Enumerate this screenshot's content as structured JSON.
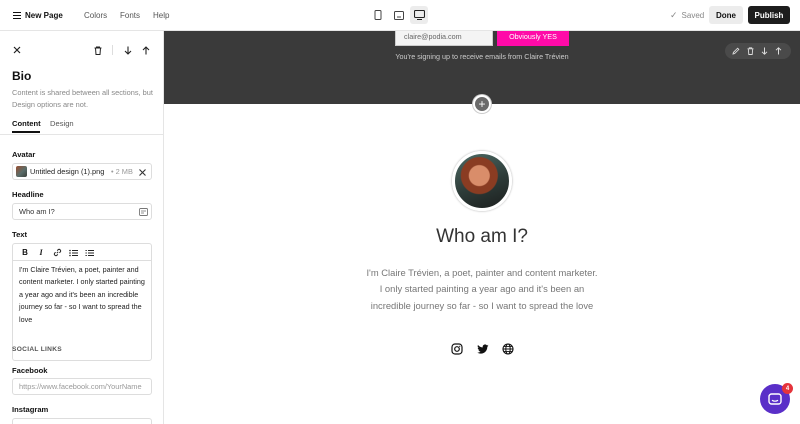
{
  "topbar": {
    "new_page": "New Page",
    "nav": {
      "colors": "Colors",
      "fonts": "Fonts",
      "help": "Help"
    },
    "saved": "Saved",
    "done": "Done",
    "publish": "Publish",
    "active_device": "desktop"
  },
  "sidebar": {
    "title": "Bio",
    "description": "Content is shared between all sections, but Design options are not.",
    "tabs": {
      "content": "Content",
      "design": "Design",
      "active": "Content"
    },
    "avatar": {
      "label": "Avatar",
      "file_name": "Untitled design (1).png",
      "file_size": "• 2 MB"
    },
    "headline": {
      "label": "Headline",
      "value": "Who am I?"
    },
    "text": {
      "label": "Text",
      "value": "I'm Claire Trévien, a poet, painter and content marketer. I only started painting a year ago and it's been an incredible journey so far - so I want to spread the love"
    },
    "social_links": {
      "heading": "SOCIAL LINKS",
      "facebook": {
        "label": "Facebook",
        "placeholder": "https://www.facebook.com/YourName"
      },
      "instagram": {
        "label": "Instagram"
      }
    }
  },
  "canvas": {
    "email_section": {
      "email_value": "claire@podia.com",
      "button_label": "Obviously YES",
      "note": "You're signing up to receive emails from Claire Trévien"
    },
    "bio": {
      "heading": "Who am I?",
      "text": "I'm Claire Trévien, a poet, painter and content marketer. I only started painting a year ago and it's been an incredible journey so far - so I want to spread the love",
      "social_icons": [
        "instagram-icon",
        "twitter-icon",
        "globe-icon"
      ]
    },
    "chat": {
      "badge_count": "4"
    }
  },
  "colors": {
    "accent": "#ff0aa8",
    "publish": "#1d1d1d",
    "dark_section": "#3a3a3a",
    "chat": "#5a2fc8",
    "badge": "#e5333b"
  }
}
